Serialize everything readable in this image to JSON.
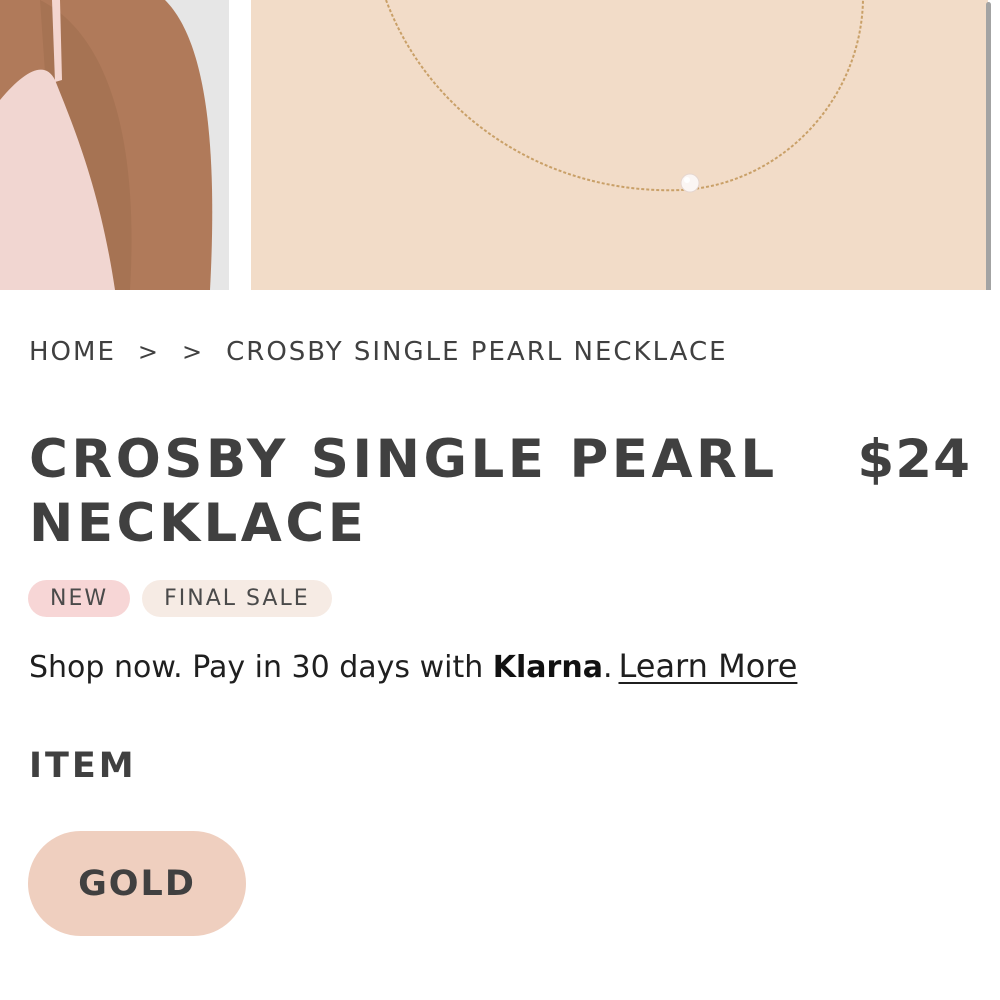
{
  "gallery": {
    "images": [
      {
        "icon": "model-wearing-necklace-photo"
      },
      {
        "icon": "pearl-necklace-product-photo"
      }
    ]
  },
  "breadcrumb": {
    "home": "HOME",
    "separator": ">",
    "current": "CROSBY SINGLE PEARL NECKLACE"
  },
  "product": {
    "title": "CROSBY SINGLE PEARL NECKLACE",
    "price": "$24",
    "badges": [
      "NEW",
      "FINAL SALE"
    ]
  },
  "klarna": {
    "text_before": "Shop now. Pay in 30 days with ",
    "brand": "Klarna",
    "text_after": ".",
    "link": "Learn More"
  },
  "options": {
    "label": "ITEM",
    "values": [
      "GOLD"
    ],
    "selected": "GOLD"
  },
  "colors": {
    "text": "#404040",
    "badge_new_bg": "#f7d6d6",
    "badge_final_bg": "#f6ebe4",
    "option_bg": "#efcfbf",
    "photo_bg": "#f2dcc8"
  }
}
